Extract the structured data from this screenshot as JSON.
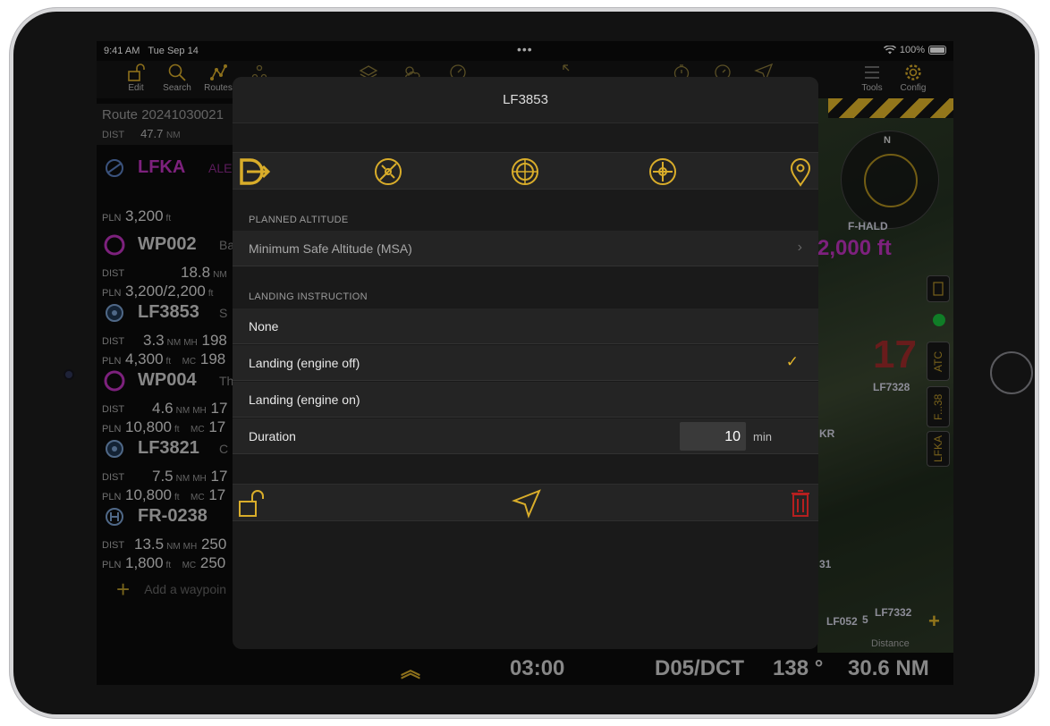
{
  "status": {
    "time": "9:41 AM",
    "date": "Tue Sep 14",
    "battery": "100%",
    "dots": "•••"
  },
  "toolbar": {
    "edit": "Edit",
    "search": "Search",
    "routes": "Routes",
    "tools": "Tools",
    "config": "Config"
  },
  "route": {
    "title": "Route 20241030021",
    "dist_label": "DIST",
    "dist_value": "47.7",
    "dist_unit": "NM"
  },
  "waypoints": [
    {
      "name": "LFKA",
      "note": "ALE",
      "pln_label": "PLN",
      "pln": "3,200",
      "pln_unit": "ft"
    },
    {
      "name": "WP002",
      "note": "Ba",
      "dist_label": "DIST",
      "dist": "18.8",
      "dist_unit": "NM",
      "pln_label": "PLN",
      "pln": "3,200/2,200",
      "pln_unit": "ft"
    },
    {
      "name": "LF3853",
      "note": "S",
      "dist_label": "DIST",
      "dist": "3.3",
      "dist_unit": "NM",
      "mh_label": "MH",
      "mh": "198",
      "pln_label": "PLN",
      "pln": "4,300",
      "pln_unit": "ft",
      "mc_label": "MC",
      "mc": "198"
    },
    {
      "name": "WP004",
      "note": "Th",
      "dist_label": "DIST",
      "dist": "4.6",
      "dist_unit": "NM",
      "mh_label": "MH",
      "mh": "17",
      "pln_label": "PLN",
      "pln": "10,800",
      "pln_unit": "ft",
      "mc_label": "MC",
      "mc": "17"
    },
    {
      "name": "LF3821",
      "note": "C",
      "dist_label": "DIST",
      "dist": "7.5",
      "dist_unit": "NM",
      "mh_label": "MH",
      "mh": "17",
      "pln_label": "PLN",
      "pln": "10,800",
      "pln_unit": "ft",
      "mc_label": "MC",
      "mc": "17"
    },
    {
      "name": "FR-0238",
      "note": "",
      "dist_label": "DIST",
      "dist": "13.5",
      "dist_unit": "NM",
      "mh_label": "MH",
      "mh": "250",
      "pln_label": "PLN",
      "pln": "1,800",
      "pln_unit": "ft",
      "mc_label": "MC",
      "mc": "250"
    }
  ],
  "add_waypoint": "Add a waypoin",
  "map": {
    "altitude": "2,000 ft",
    "sector_number": "17",
    "labels": {
      "f_hald": "F-HALD",
      "lf7328": "LF7328",
      "kr": "KR",
      "lf7332": "LF7332",
      "lf052": "LF052",
      "n31": "31",
      "n5": "5"
    },
    "tabs": {
      "atc": "ATC",
      "f38": "F...38",
      "lfka": "LFKA"
    },
    "compass_n": "N",
    "plus": "+"
  },
  "bottom": {
    "time": "03:00",
    "route": "D05/DCT",
    "heading": "138 °",
    "distance": "30.6 NM",
    "distance_label": "Distance"
  },
  "modal": {
    "title": "LF3853",
    "planned_altitude_section": "PLANNED ALTITUDE",
    "planned_altitude_value": "Minimum Safe Altitude (MSA)",
    "landing_section": "LANDING INSTRUCTION",
    "options": [
      "None",
      "Landing (engine off)",
      "Landing (engine on)"
    ],
    "selected": "Landing (engine off)",
    "duration_label": "Duration",
    "duration_value": "10",
    "duration_unit": "min"
  },
  "colors": {
    "accent": "#d9ad2a",
    "magenta": "#c033c0",
    "delete": "#b51f1f"
  }
}
